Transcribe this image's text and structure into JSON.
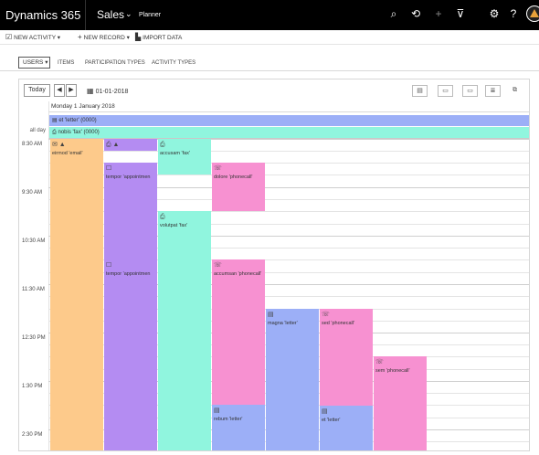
{
  "topbar": {
    "brand": "Dynamics 365",
    "app": "Sales",
    "app_chevron": "⌄",
    "area": "Planner",
    "icons": {
      "search": "⌕",
      "recent": "⟲",
      "new": "+",
      "filter": "⊽",
      "settings": "⚙",
      "help": "?"
    }
  },
  "commands": {
    "new_activity": "NEW ACTIVITY",
    "new_record": "NEW RECORD",
    "import_data": "IMPORT DATA",
    "caret": "▾"
  },
  "filters": {
    "users": "USERS",
    "users_caret": "▾",
    "tabs": [
      "ITEMS",
      "PARTICIPATION TYPES",
      "ACTIVITY TYPES"
    ]
  },
  "calendar": {
    "today": "Today",
    "prev": "◀",
    "next": "▶",
    "date": "01-01-2018",
    "date_icon": "▦",
    "day_header": "Monday 1 January 2018",
    "allday_label": "all day",
    "allday_events": [
      {
        "icon": "▤",
        "title": "et 'letter' (0000)",
        "color": "#9caff7"
      },
      {
        "icon": "⎙",
        "title": "nobis 'fax' (0000)",
        "color": "#90f5de"
      }
    ],
    "time_labels": [
      "8:30 AM",
      "9:30 AM",
      "10:30 AM",
      "11:30 AM",
      "12:30 PM",
      "1:30 PM",
      "2:30 PM"
    ],
    "events": [
      {
        "icons": "✉  ▲",
        "title": "eirmod 'email'",
        "color": "#fdca8b"
      },
      {
        "icons": "⎙  ▲",
        "title": "",
        "color": "#b48cf2"
      },
      {
        "icons": "⎙",
        "title": "accusam 'fax'",
        "color": "#90f5de"
      },
      {
        "icons": "☐",
        "title": "tempor 'appointmen",
        "color": "#b48cf2"
      },
      {
        "icons": "☏",
        "title": "dolore 'phonecall'",
        "color": "#f791d1"
      },
      {
        "icons": "⎙",
        "title": "volutpat 'fax'",
        "color": "#90f5de"
      },
      {
        "icons": "☐",
        "title": "tempor 'appointmen",
        "color": "#b48cf2"
      },
      {
        "icons": "☏",
        "title": "accumsan 'phonecall'",
        "color": "#f791d1"
      },
      {
        "icons": "▤",
        "title": "magna 'letter'",
        "color": "#9caff7"
      },
      {
        "icons": "☏",
        "title": "sed 'phonecall'",
        "color": "#f791d1"
      },
      {
        "icons": "☏",
        "title": "sem 'phonecall'",
        "color": "#f791d1"
      },
      {
        "icons": "▤",
        "title": "rebum 'letter'",
        "color": "#9caff7"
      },
      {
        "icons": "▤",
        "title": "et 'letter'",
        "color": "#9caff7"
      }
    ]
  }
}
